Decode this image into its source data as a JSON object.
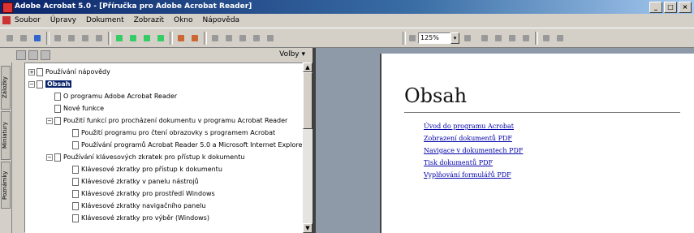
{
  "window": {
    "title": "Adobe Acrobat 5.0 - [Příručka pro Adobe Acrobat Reader]",
    "controls": [
      "_",
      "□",
      "×"
    ]
  },
  "menubar": {
    "items": [
      "Soubor",
      "Úpravy",
      "Dokument",
      "Zobrazit",
      "Okno",
      "Nápověda"
    ]
  },
  "toolbar": {
    "zoom_value": "125%",
    "zoom_dropdown": "▾"
  },
  "sidebar": {
    "tabs": [
      "Záložky",
      "Miniatury",
      "Poznámky"
    ],
    "menu_button_label": "Volby ▾",
    "tree": [
      {
        "label": "Používání nápovědy",
        "level": 0,
        "expander": "+",
        "selected": false
      },
      {
        "label": "Obsah",
        "level": 0,
        "expander": "−",
        "selected": true
      },
      {
        "label": "O programu Adobe Acrobat Reader",
        "level": 1,
        "expander": "",
        "selected": false
      },
      {
        "label": "Nové funkce",
        "level": 1,
        "expander": "",
        "selected": false
      },
      {
        "label": "Použití funkcí pro procházení dokumentu v programu Acrobat Reader",
        "level": 1,
        "expander": "−",
        "selected": false
      },
      {
        "label": "Použití programu pro čtení obrazovky s programem Acrobat",
        "level": 2,
        "expander": "",
        "selected": false
      },
      {
        "label": "Používání programů Acrobat Reader 5.0 a Microsoft Internet Explorer",
        "level": 2,
        "expander": "",
        "selected": false
      },
      {
        "label": "Používání klávesových zkratek pro přístup k dokumentu",
        "level": 1,
        "expander": "−",
        "selected": false
      },
      {
        "label": "Klávesové zkratky pro přístup k dokumentu",
        "level": 2,
        "expander": "",
        "selected": false
      },
      {
        "label": "Klávesové zkratky v panelu nástrojů",
        "level": 2,
        "expander": "",
        "selected": false
      },
      {
        "label": "Klávesové zkratky pro prostředí Windows",
        "level": 2,
        "expander": "",
        "selected": false
      },
      {
        "label": "Klávesové zkratky navigačního panelu",
        "level": 2,
        "expander": "",
        "selected": false
      },
      {
        "label": "Klávesové zkratky pro výběr (Windows)",
        "level": 2,
        "expander": "",
        "selected": false
      }
    ]
  },
  "document": {
    "title": "Obsah",
    "toc_links": [
      "Úvod do programu Acrobat",
      "Zobrazení dokumentů PDF",
      "Navigace v dokumentech PDF",
      "Tisk dokumentů PDF",
      "Vyplňování formulářů PDF"
    ]
  }
}
